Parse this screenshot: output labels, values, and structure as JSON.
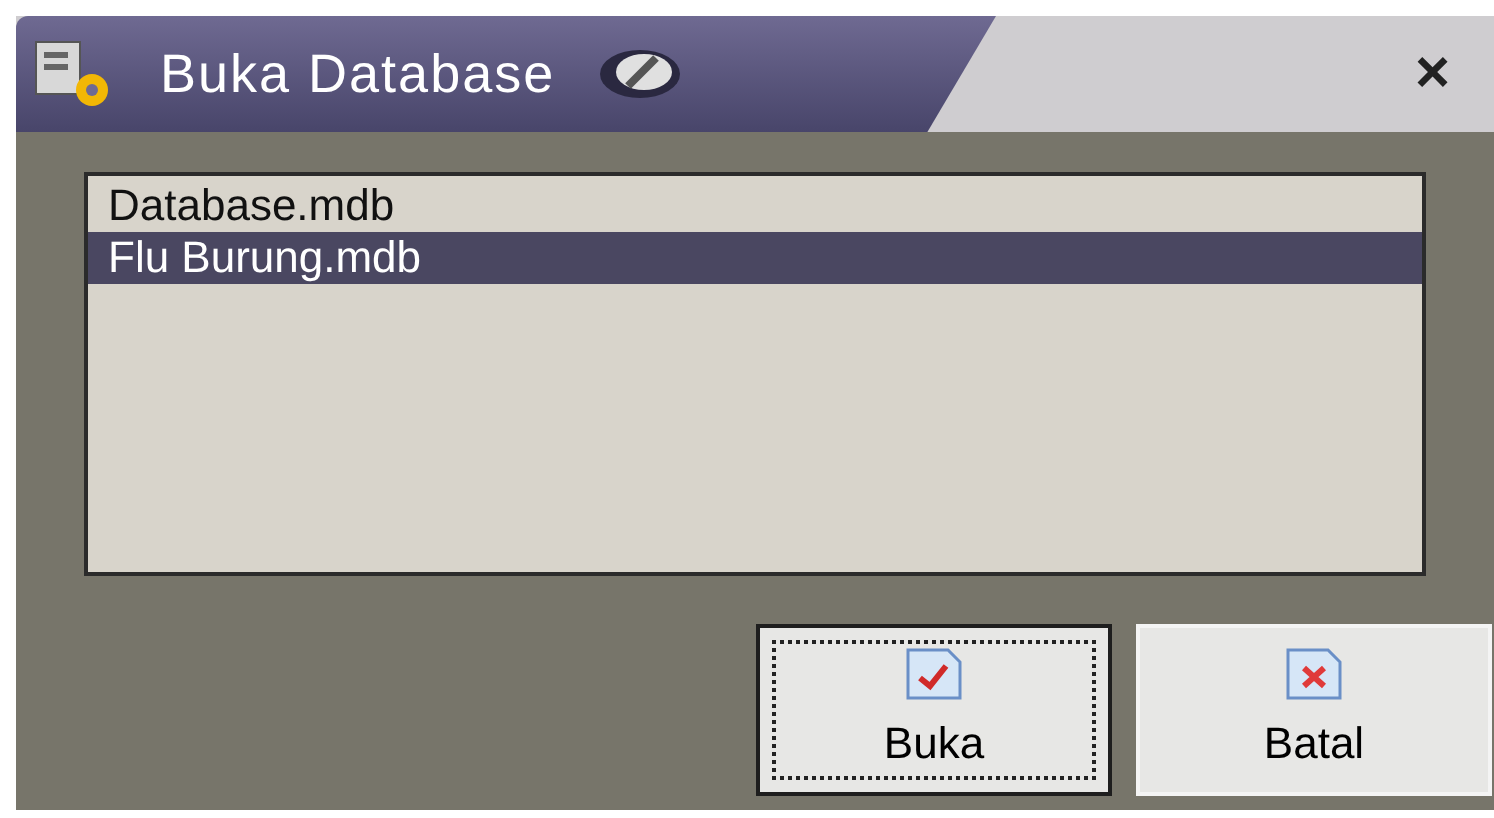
{
  "window": {
    "title": "Buka Database",
    "close": "×"
  },
  "files": [
    {
      "name": "Database.mdb",
      "selected": false
    },
    {
      "name": "Flu Burung.mdb",
      "selected": true
    }
  ],
  "buttons": [
    {
      "label": "Buka",
      "kind": "ok",
      "focused": true
    },
    {
      "label": "Batal",
      "kind": "cancel",
      "focused": false
    }
  ]
}
